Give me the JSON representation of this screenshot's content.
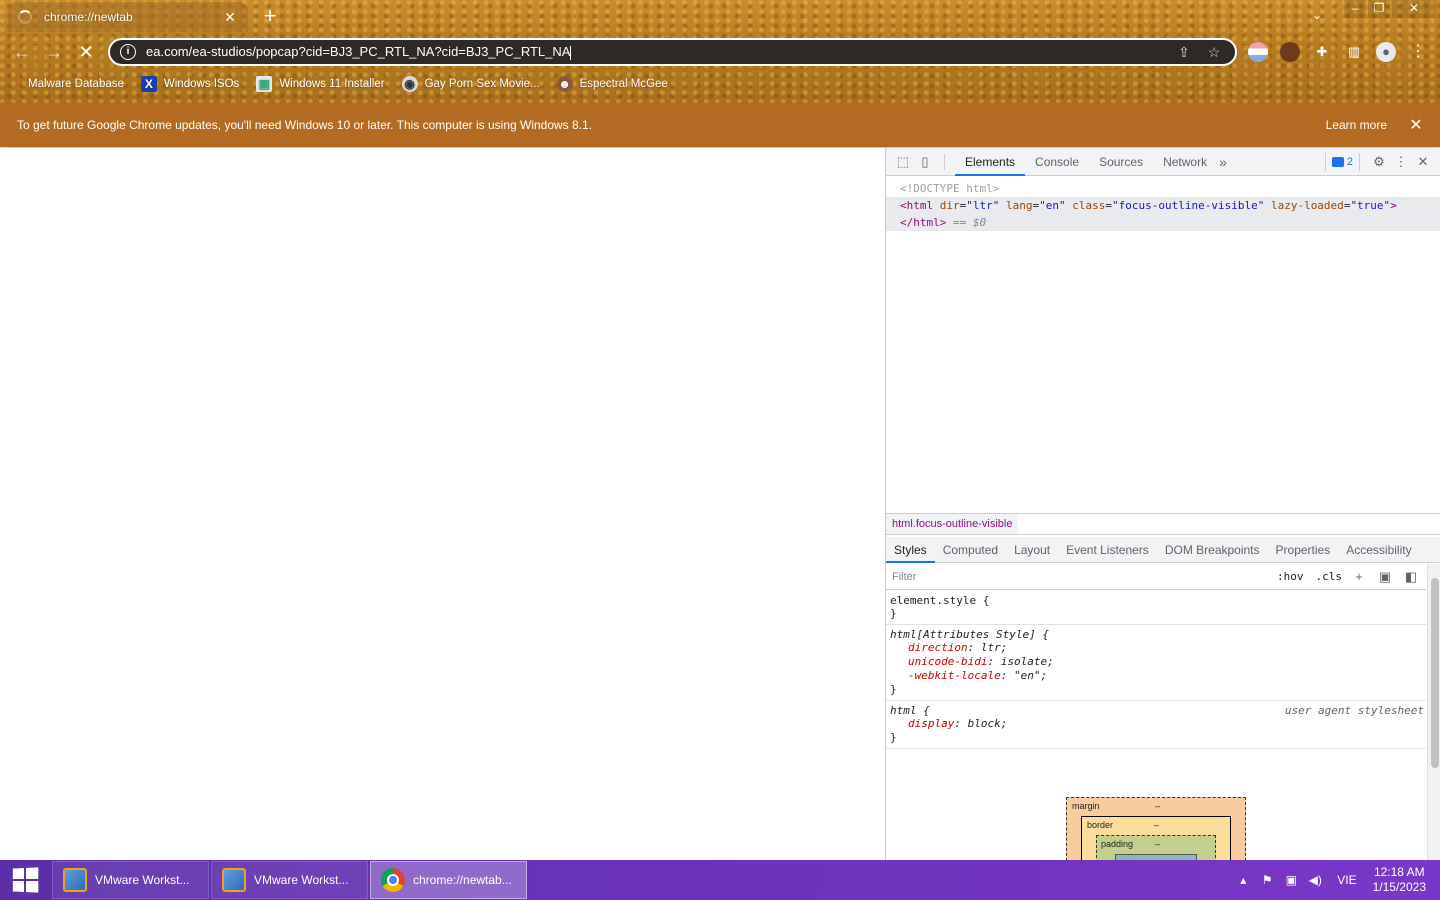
{
  "browser": {
    "tab_title": "chrome://newtab",
    "omnibox_url": "ea.com/ea-studios/popcap?cid=BJ3_PC_RTL_NA?cid=BJ3_PC_RTL_NA",
    "bookmarks": [
      {
        "label": "Malware Database",
        "icon": "bookmark-dot-icon"
      },
      {
        "label": "Windows ISOs",
        "icon": "x-logo-icon"
      },
      {
        "label": "Windows 11 Installer",
        "icon": "image-icon"
      },
      {
        "label": "Gay Porn Sex Movie...",
        "icon": "site-icon"
      },
      {
        "label": "Espectral McGee",
        "icon": "avatar-icon"
      }
    ]
  },
  "infobar": {
    "message": "To get future Google Chrome updates, you'll need Windows 10 or later. This computer is using Windows 8.1.",
    "learn_more": "Learn more"
  },
  "devtools": {
    "tabs": [
      "Elements",
      "Console",
      "Sources",
      "Network"
    ],
    "active_tab": "Elements",
    "issues_count": "2",
    "dom": {
      "doctype": "<!DOCTYPE html>",
      "html_open_tag": "html",
      "attrs": [
        {
          "name": "dir",
          "value": "\"ltr\""
        },
        {
          "name": "lang",
          "value": "\"en\""
        },
        {
          "name": "class",
          "value": "\"focus-outline-visible\""
        },
        {
          "name": "lazy-loaded",
          "value": "\"true\""
        }
      ],
      "html_close": "</html>",
      "eq": "== $0"
    },
    "breadcrumb": "html.focus-outline-visible",
    "sub_tabs": [
      "Styles",
      "Computed",
      "Layout",
      "Event Listeners",
      "DOM Breakpoints",
      "Properties",
      "Accessibility"
    ],
    "filter_placeholder": "Filter",
    "hov": ":hov",
    "cls": ".cls",
    "rules": {
      "element_style": "element.style {",
      "attr_selector": "html[Attributes Style] {",
      "attr_props": [
        {
          "name": "direction",
          "value": "ltr;"
        },
        {
          "name": "unicode-bidi",
          "value": "isolate;"
        },
        {
          "name": "-webkit-locale",
          "value": "\"en\";"
        }
      ],
      "html_selector": "html {",
      "html_origin": "user agent stylesheet",
      "html_props": [
        {
          "name": "display",
          "value": "block;"
        }
      ],
      "close": "}"
    },
    "box_model": {
      "margin_label": "margin",
      "border_label": "border",
      "padding_label": "padding",
      "dash": "–"
    }
  },
  "taskbar": {
    "items": [
      {
        "label": "VMware Workst...",
        "icon": "vmware-icon"
      },
      {
        "label": "VMware Workst...",
        "icon": "vmware-icon"
      },
      {
        "label": "chrome://newtab...",
        "icon": "chrome-icon"
      }
    ],
    "lang": "VIE",
    "time": "12:18 AM",
    "date": "1/15/2023"
  }
}
